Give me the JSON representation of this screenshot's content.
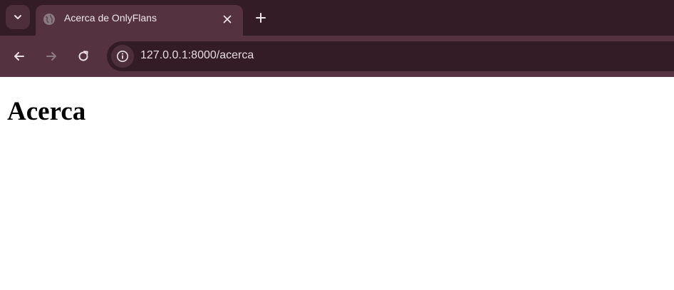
{
  "browser": {
    "tab": {
      "title": "Acerca de OnlyFlans",
      "favicon_icon": "globe-icon",
      "close_icon": "close-icon"
    },
    "tab_search_icon": "chevron-down-icon",
    "new_tab_icon": "plus-icon",
    "toolbar": {
      "back_icon": "arrow-left-icon",
      "forward_icon": "arrow-right-icon",
      "reload_icon": "reload-icon",
      "site_info_icon": "info-icon",
      "url": "127.0.0.1:8000/acerca"
    },
    "colors": {
      "tabstrip_bg": "#331c25",
      "active_tab_bg": "#55323f",
      "omnibox_bg": "#331c25"
    }
  },
  "page": {
    "heading": "Acerca"
  }
}
